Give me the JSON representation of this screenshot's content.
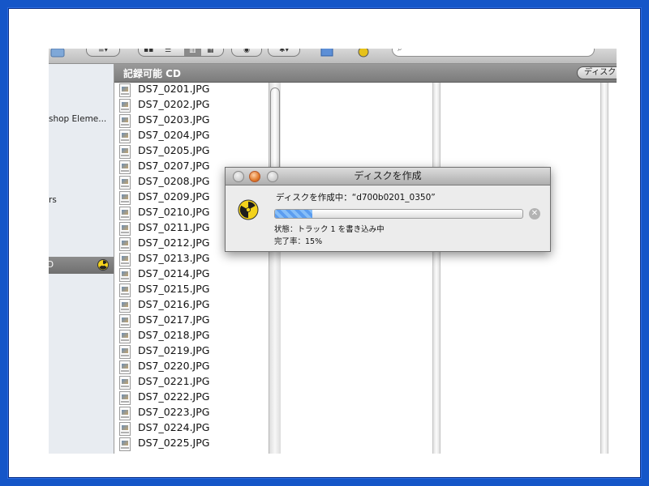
{
  "sidebar": {
    "items": [
      {
        "label": "shop Eleme..."
      },
      {
        "label": "rs"
      }
    ],
    "selected": {
      "label": "D"
    }
  },
  "column_header": {
    "title": "記録可能 CD",
    "burn_button_label": "ディスク"
  },
  "files": [
    "DS7_0201.JPG",
    "DS7_0202.JPG",
    "DS7_0203.JPG",
    "DS7_0204.JPG",
    "DS7_0205.JPG",
    "DS7_0207.JPG",
    "DS7_0208.JPG",
    "DS7_0209.JPG",
    "DS7_0210.JPG",
    "DS7_0211.JPG",
    "DS7_0212.JPG",
    "DS7_0213.JPG",
    "DS7_0214.JPG",
    "DS7_0215.JPG",
    "DS7_0216.JPG",
    "DS7_0217.JPG",
    "DS7_0218.JPG",
    "DS7_0219.JPG",
    "DS7_0220.JPG",
    "DS7_0221.JPG",
    "DS7_0222.JPG",
    "DS7_0223.JPG",
    "DS7_0224.JPG",
    "DS7_0225.JPG"
  ],
  "dialog": {
    "title": "ディスクを作成",
    "message": "ディスクを作成中：“d700b0201_0350”",
    "progress_fraction": 0.15,
    "status": "状態：トラック 1 を書き込み中",
    "rate": "完了率：15%"
  },
  "colors": {
    "frame": "#1556c8",
    "progress": "#5b9df0"
  }
}
